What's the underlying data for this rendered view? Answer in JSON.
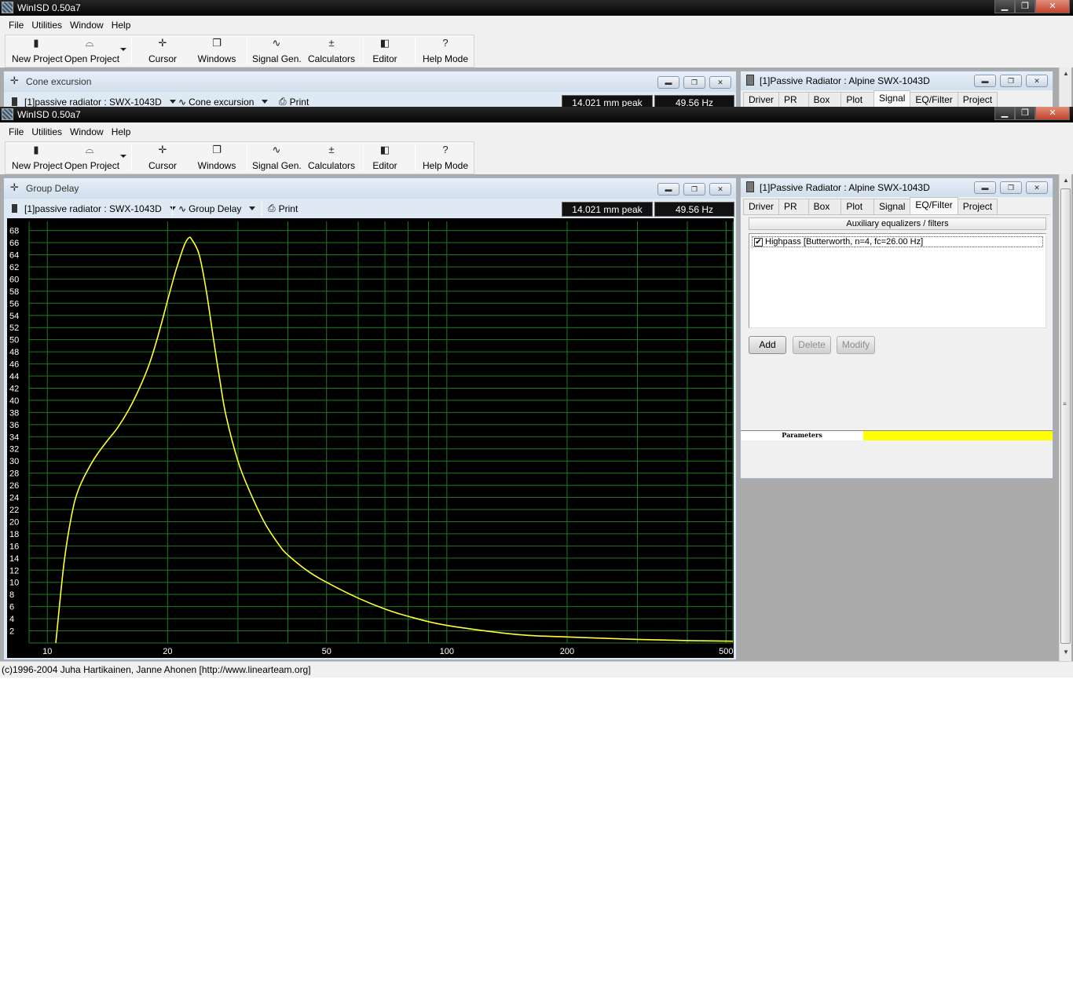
{
  "window": {
    "title": "WinISD 0.50a7",
    "min_glyph": "▁",
    "max_glyph": "❐",
    "close_glyph": "✕"
  },
  "menu": {
    "items": [
      "File",
      "Utilities",
      "Window",
      "Help"
    ]
  },
  "toolbar": {
    "new_project": "New Project",
    "open_project": "Open Project",
    "cursor": "Cursor",
    "windows": "Windows",
    "signal_gen": "Signal Gen.",
    "calculators": "Calculators",
    "editor": "Editor",
    "help_mode": "Help Mode",
    "icons": {
      "new_project": "▮",
      "open_project": "⌓",
      "cursor": "✛",
      "windows": "❐",
      "signal_gen": "∿",
      "calculators": "±",
      "editor": "◧",
      "help_mode": "?"
    }
  },
  "back_child": {
    "title": "Cone excursion",
    "driver_select": "[1]passive radiator : SWX-1043D",
    "graph_select": "Cone excursion",
    "print": "Print",
    "readout_value": "14.021 mm peak",
    "readout_freq": "49.56 Hz"
  },
  "child": {
    "title": "Group Delay",
    "driver_select": "[1]passive radiator : SWX-1043D",
    "graph_select": "Group Delay",
    "print": "Print",
    "readout_value": "14.021 mm peak",
    "readout_freq": "49.56 Hz",
    "pin_glyph": "✛",
    "ctl_min": "▬",
    "ctl_max": "❐",
    "ctl_close": "✕",
    "wave_glyph": "∿",
    "print_glyph": "⎙"
  },
  "panel": {
    "title": "[1]Passive Radiator : Alpine SWX-1043D",
    "tabs": [
      "Driver",
      "PR",
      "Box",
      "Plot",
      "Signal",
      "EQ/Filter",
      "Project"
    ],
    "back_active_tab": "Signal",
    "active_tab": "EQ/Filter",
    "aux_header": "Auxiliary equalizers / filters",
    "filters": [
      {
        "checked": true,
        "label": "Highpass [Butterworth, n=4, fc=26.00 Hz]"
      }
    ],
    "check_glyph": "✔",
    "buttons": {
      "add": "Add",
      "delete": "Delete",
      "modify": "Modify"
    },
    "params_label": "Parameters",
    "params_color": "#ffff00"
  },
  "status": {
    "text": "(c)1996-2004 Juha Hartikainen, Janne Ahonen [http://www.linearteam.org]"
  },
  "chart_data": {
    "type": "line",
    "title": "",
    "xlabel": "",
    "ylabel": "",
    "x_scale": "log",
    "xlim": [
      9,
      520
    ],
    "ylim": [
      0,
      69.5
    ],
    "x_ticks": [
      10,
      20,
      50,
      100,
      200,
      500
    ],
    "y_ticks": [
      2,
      4,
      6,
      8,
      10,
      12,
      14,
      16,
      18,
      20,
      22,
      24,
      26,
      28,
      30,
      32,
      34,
      36,
      38,
      40,
      42,
      44,
      46,
      48,
      50,
      52,
      54,
      56,
      58,
      60,
      62,
      64,
      66,
      68
    ],
    "grid": true,
    "background": "#000000",
    "grid_color": "#1f7a1f",
    "line_color": "#ffff33",
    "series": [
      {
        "x": [
          10.5,
          11,
          11.5,
          12,
          13,
          14,
          15,
          16,
          17,
          18,
          19,
          20,
          21,
          22,
          22.6,
          23,
          24,
          25,
          26,
          27,
          28,
          30,
          32,
          35,
          38,
          40,
          45,
          50,
          60,
          70,
          80,
          100,
          150,
          200,
          300,
          400,
          520
        ],
        "y": [
          0,
          13,
          21,
          25.5,
          30,
          33,
          35.5,
          38.5,
          42,
          46,
          51,
          56.5,
          61.5,
          65.5,
          66.8,
          66.5,
          64,
          58,
          50.5,
          43.5,
          37.5,
          30,
          25.2,
          19.8,
          16.2,
          14.5,
          11.8,
          10,
          7.4,
          5.6,
          4.4,
          2.9,
          1.4,
          1.0,
          0.6,
          0.4,
          0.3
        ]
      }
    ]
  }
}
